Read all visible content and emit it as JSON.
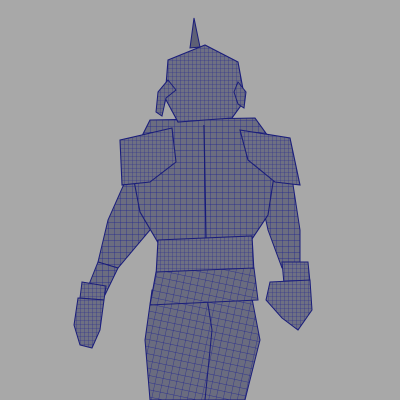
{
  "viewport": {
    "background_color": "#a8a8a8",
    "model": {
      "name_icon": "armored-warrior-wireframe",
      "surface_color": "#6b6d80",
      "wire_color": "#1c1f8f",
      "shading": "wireframe-on-shaded"
    }
  }
}
